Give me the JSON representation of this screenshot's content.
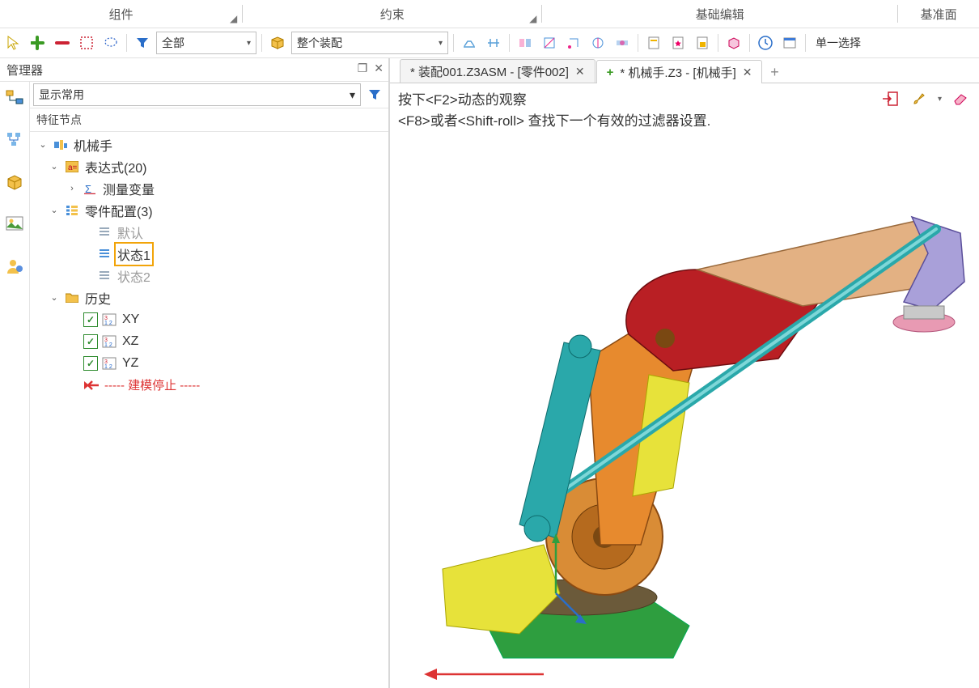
{
  "ribbon": {
    "groups": [
      {
        "label": "组件",
        "launcher": true
      },
      {
        "label": "约束",
        "launcher": true
      },
      {
        "label": "基础编辑",
        "launcher": false
      },
      {
        "label": "基准面",
        "launcher": false
      }
    ]
  },
  "toolbar": {
    "combo_all": "全部",
    "combo_assembly": "整个装配",
    "combo_select_mode": "单一选择"
  },
  "manager": {
    "title": "管理器",
    "filter_combo": "显示常用",
    "tree_header": "特征节点"
  },
  "tree": {
    "root": "机械手",
    "expr": "表达式(20)",
    "measure": "测量变量",
    "config": "零件配置(3)",
    "cfg_default": "默认",
    "cfg_state1": "状态1",
    "cfg_state2": "状态2",
    "history": "历史",
    "plane_xy": "XY",
    "plane_xz": "XZ",
    "plane_yz": "YZ",
    "stop": "----- 建模停止 -----"
  },
  "tabs": {
    "t1": "* 装配001.Z3ASM - [零件002]",
    "t2": "* 机械手.Z3 - [机械手]"
  },
  "viewport": {
    "hint1": "按下<F2>动态的观察",
    "hint2": "<F8>或者<Shift-roll> 查找下一个有效的过滤器设置."
  }
}
